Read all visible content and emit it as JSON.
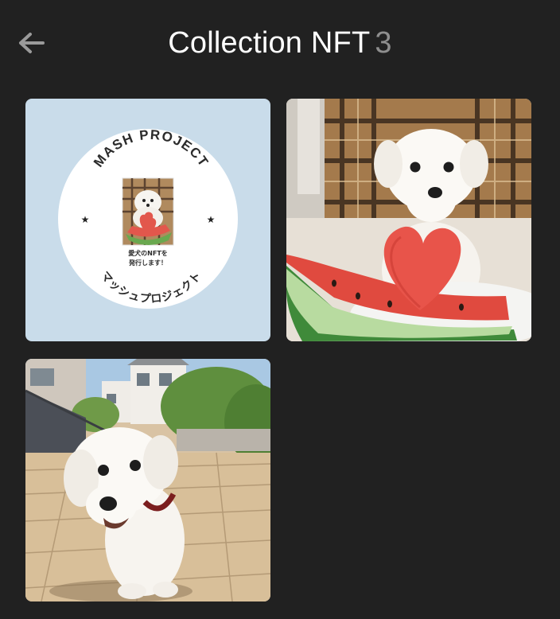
{
  "header": {
    "title": "Collection NFT",
    "count": "3",
    "back_icon": "arrow-left-icon"
  },
  "colors": {
    "background": "#212121",
    "title": "#ffffff",
    "count": "#8e8e8e",
    "back_icon": "#9a9a9a"
  },
  "nfts": [
    {
      "name": "nft-mash-project-logo",
      "logo": {
        "top_text": "MASH PROJECT",
        "bottom_text": "マッシュプロジェクト",
        "center_line1": "愛犬のNFTを",
        "center_line2": "発行します！"
      }
    },
    {
      "name": "nft-dog-watermelon-heart"
    },
    {
      "name": "nft-dog-walking"
    }
  ]
}
